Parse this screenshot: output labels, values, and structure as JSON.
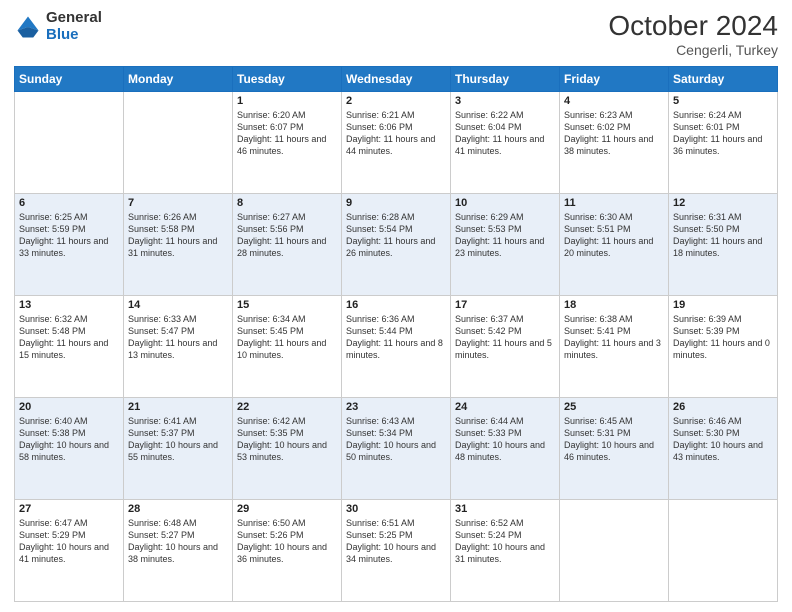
{
  "header": {
    "logo_general": "General",
    "logo_blue": "Blue",
    "month_title": "October 2024",
    "location": "Cengerli, Turkey"
  },
  "days_of_week": [
    "Sunday",
    "Monday",
    "Tuesday",
    "Wednesday",
    "Thursday",
    "Friday",
    "Saturday"
  ],
  "weeks": [
    [
      {
        "day": "",
        "sunrise": "",
        "sunset": "",
        "daylight": ""
      },
      {
        "day": "",
        "sunrise": "",
        "sunset": "",
        "daylight": ""
      },
      {
        "day": "1",
        "sunrise": "Sunrise: 6:20 AM",
        "sunset": "Sunset: 6:07 PM",
        "daylight": "Daylight: 11 hours and 46 minutes."
      },
      {
        "day": "2",
        "sunrise": "Sunrise: 6:21 AM",
        "sunset": "Sunset: 6:06 PM",
        "daylight": "Daylight: 11 hours and 44 minutes."
      },
      {
        "day": "3",
        "sunrise": "Sunrise: 6:22 AM",
        "sunset": "Sunset: 6:04 PM",
        "daylight": "Daylight: 11 hours and 41 minutes."
      },
      {
        "day": "4",
        "sunrise": "Sunrise: 6:23 AM",
        "sunset": "Sunset: 6:02 PM",
        "daylight": "Daylight: 11 hours and 38 minutes."
      },
      {
        "day": "5",
        "sunrise": "Sunrise: 6:24 AM",
        "sunset": "Sunset: 6:01 PM",
        "daylight": "Daylight: 11 hours and 36 minutes."
      }
    ],
    [
      {
        "day": "6",
        "sunrise": "Sunrise: 6:25 AM",
        "sunset": "Sunset: 5:59 PM",
        "daylight": "Daylight: 11 hours and 33 minutes."
      },
      {
        "day": "7",
        "sunrise": "Sunrise: 6:26 AM",
        "sunset": "Sunset: 5:58 PM",
        "daylight": "Daylight: 11 hours and 31 minutes."
      },
      {
        "day": "8",
        "sunrise": "Sunrise: 6:27 AM",
        "sunset": "Sunset: 5:56 PM",
        "daylight": "Daylight: 11 hours and 28 minutes."
      },
      {
        "day": "9",
        "sunrise": "Sunrise: 6:28 AM",
        "sunset": "Sunset: 5:54 PM",
        "daylight": "Daylight: 11 hours and 26 minutes."
      },
      {
        "day": "10",
        "sunrise": "Sunrise: 6:29 AM",
        "sunset": "Sunset: 5:53 PM",
        "daylight": "Daylight: 11 hours and 23 minutes."
      },
      {
        "day": "11",
        "sunrise": "Sunrise: 6:30 AM",
        "sunset": "Sunset: 5:51 PM",
        "daylight": "Daylight: 11 hours and 20 minutes."
      },
      {
        "day": "12",
        "sunrise": "Sunrise: 6:31 AM",
        "sunset": "Sunset: 5:50 PM",
        "daylight": "Daylight: 11 hours and 18 minutes."
      }
    ],
    [
      {
        "day": "13",
        "sunrise": "Sunrise: 6:32 AM",
        "sunset": "Sunset: 5:48 PM",
        "daylight": "Daylight: 11 hours and 15 minutes."
      },
      {
        "day": "14",
        "sunrise": "Sunrise: 6:33 AM",
        "sunset": "Sunset: 5:47 PM",
        "daylight": "Daylight: 11 hours and 13 minutes."
      },
      {
        "day": "15",
        "sunrise": "Sunrise: 6:34 AM",
        "sunset": "Sunset: 5:45 PM",
        "daylight": "Daylight: 11 hours and 10 minutes."
      },
      {
        "day": "16",
        "sunrise": "Sunrise: 6:36 AM",
        "sunset": "Sunset: 5:44 PM",
        "daylight": "Daylight: 11 hours and 8 minutes."
      },
      {
        "day": "17",
        "sunrise": "Sunrise: 6:37 AM",
        "sunset": "Sunset: 5:42 PM",
        "daylight": "Daylight: 11 hours and 5 minutes."
      },
      {
        "day": "18",
        "sunrise": "Sunrise: 6:38 AM",
        "sunset": "Sunset: 5:41 PM",
        "daylight": "Daylight: 11 hours and 3 minutes."
      },
      {
        "day": "19",
        "sunrise": "Sunrise: 6:39 AM",
        "sunset": "Sunset: 5:39 PM",
        "daylight": "Daylight: 11 hours and 0 minutes."
      }
    ],
    [
      {
        "day": "20",
        "sunrise": "Sunrise: 6:40 AM",
        "sunset": "Sunset: 5:38 PM",
        "daylight": "Daylight: 10 hours and 58 minutes."
      },
      {
        "day": "21",
        "sunrise": "Sunrise: 6:41 AM",
        "sunset": "Sunset: 5:37 PM",
        "daylight": "Daylight: 10 hours and 55 minutes."
      },
      {
        "day": "22",
        "sunrise": "Sunrise: 6:42 AM",
        "sunset": "Sunset: 5:35 PM",
        "daylight": "Daylight: 10 hours and 53 minutes."
      },
      {
        "day": "23",
        "sunrise": "Sunrise: 6:43 AM",
        "sunset": "Sunset: 5:34 PM",
        "daylight": "Daylight: 10 hours and 50 minutes."
      },
      {
        "day": "24",
        "sunrise": "Sunrise: 6:44 AM",
        "sunset": "Sunset: 5:33 PM",
        "daylight": "Daylight: 10 hours and 48 minutes."
      },
      {
        "day": "25",
        "sunrise": "Sunrise: 6:45 AM",
        "sunset": "Sunset: 5:31 PM",
        "daylight": "Daylight: 10 hours and 46 minutes."
      },
      {
        "day": "26",
        "sunrise": "Sunrise: 6:46 AM",
        "sunset": "Sunset: 5:30 PM",
        "daylight": "Daylight: 10 hours and 43 minutes."
      }
    ],
    [
      {
        "day": "27",
        "sunrise": "Sunrise: 6:47 AM",
        "sunset": "Sunset: 5:29 PM",
        "daylight": "Daylight: 10 hours and 41 minutes."
      },
      {
        "day": "28",
        "sunrise": "Sunrise: 6:48 AM",
        "sunset": "Sunset: 5:27 PM",
        "daylight": "Daylight: 10 hours and 38 minutes."
      },
      {
        "day": "29",
        "sunrise": "Sunrise: 6:50 AM",
        "sunset": "Sunset: 5:26 PM",
        "daylight": "Daylight: 10 hours and 36 minutes."
      },
      {
        "day": "30",
        "sunrise": "Sunrise: 6:51 AM",
        "sunset": "Sunset: 5:25 PM",
        "daylight": "Daylight: 10 hours and 34 minutes."
      },
      {
        "day": "31",
        "sunrise": "Sunrise: 6:52 AM",
        "sunset": "Sunset: 5:24 PM",
        "daylight": "Daylight: 10 hours and 31 minutes."
      },
      {
        "day": "",
        "sunrise": "",
        "sunset": "",
        "daylight": ""
      },
      {
        "day": "",
        "sunrise": "",
        "sunset": "",
        "daylight": ""
      }
    ]
  ]
}
